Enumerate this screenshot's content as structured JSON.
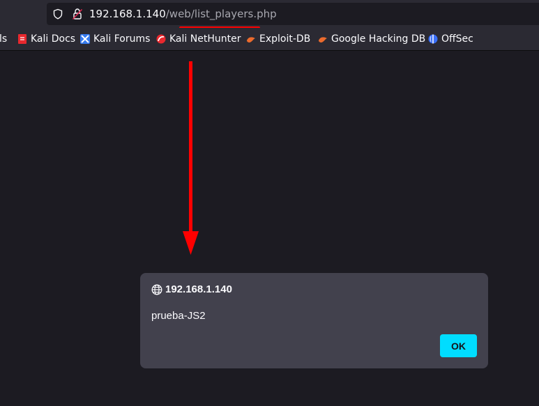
{
  "browser": {
    "url_host": "192.168.1.140",
    "url_path": "/web/list_players.php",
    "bookmarks": [
      {
        "label": "ls",
        "icon": "kali-tools-icon"
      },
      {
        "label": "Kali Docs",
        "icon": "kali-docs-icon"
      },
      {
        "label": "Kali Forums",
        "icon": "kali-forums-icon"
      },
      {
        "label": "Kali NetHunter",
        "icon": "kali-nethunter-icon"
      },
      {
        "label": "Exploit-DB",
        "icon": "exploit-db-icon"
      },
      {
        "label": "Google Hacking DB",
        "icon": "google-hacking-db-icon"
      },
      {
        "label": "OffSec",
        "icon": "offsec-icon"
      }
    ]
  },
  "dialog": {
    "origin": "192.168.1.140",
    "message": "prueba-JS2",
    "ok_label": "OK"
  },
  "colors": {
    "annotation": "#ff0000",
    "ok_button": "#00ddff",
    "dialog_bg": "#42414d",
    "page_bg": "#1c1b22"
  }
}
